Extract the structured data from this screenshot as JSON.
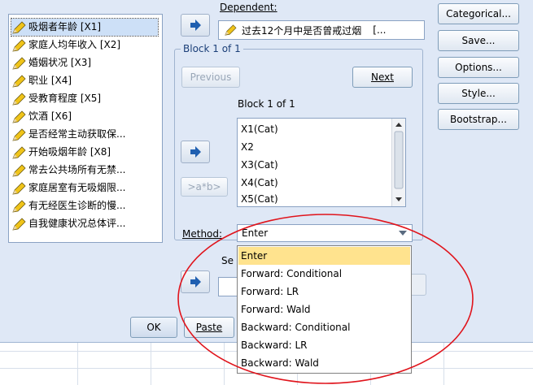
{
  "dependent": {
    "label": "Dependent:",
    "value": "过去12个月中是否曾戒过烟",
    "ellipsis": "[..."
  },
  "variables": [
    "吸烟者年龄 [X1]",
    "家庭人均年收入 [X2]",
    "婚姻状况 [X3]",
    "职业 [X4]",
    "受教育程度 [X5]",
    "饮酒 [X6]",
    "是否经常主动获取保...",
    "开始吸烟年龄 [X8]",
    "常去公共场所有无禁...",
    "家庭居室有无吸烟限...",
    "有无经医生诊断的慢...",
    "自我健康状况总体评..."
  ],
  "block": {
    "header": "Block 1 of 1",
    "previous_label": "Previous",
    "next_label": "Next",
    "inner_label": "Block 1 of 1",
    "interaction_label": ">a*b>",
    "covariates": [
      "X1(Cat)",
      "X2",
      "X3(Cat)",
      "X4(Cat)",
      "X5(Cat)"
    ]
  },
  "method": {
    "label": "Method:",
    "selected": "Enter",
    "options": [
      "Enter",
      "Forward: Conditional",
      "Forward: LR",
      "Forward: Wald",
      "Backward: Conditional",
      "Backward: LR",
      "Backward: Wald"
    ]
  },
  "selection": {
    "label_partial": "Se"
  },
  "buttons": {
    "categorical": "Categorical...",
    "save": "Save...",
    "options": "Options...",
    "style": "Style...",
    "bootstrap": "Bootstrap...",
    "ok": "OK",
    "paste": "Paste"
  },
  "colors": {
    "dialog_bg": "#dfe8f6",
    "arrow_blue": "#1f5fb0",
    "highlight": "#ffe38e",
    "annotation": "#e0141c"
  },
  "icons": {
    "variable": "scale-pencil-icon",
    "move": "right-arrow-icon"
  }
}
